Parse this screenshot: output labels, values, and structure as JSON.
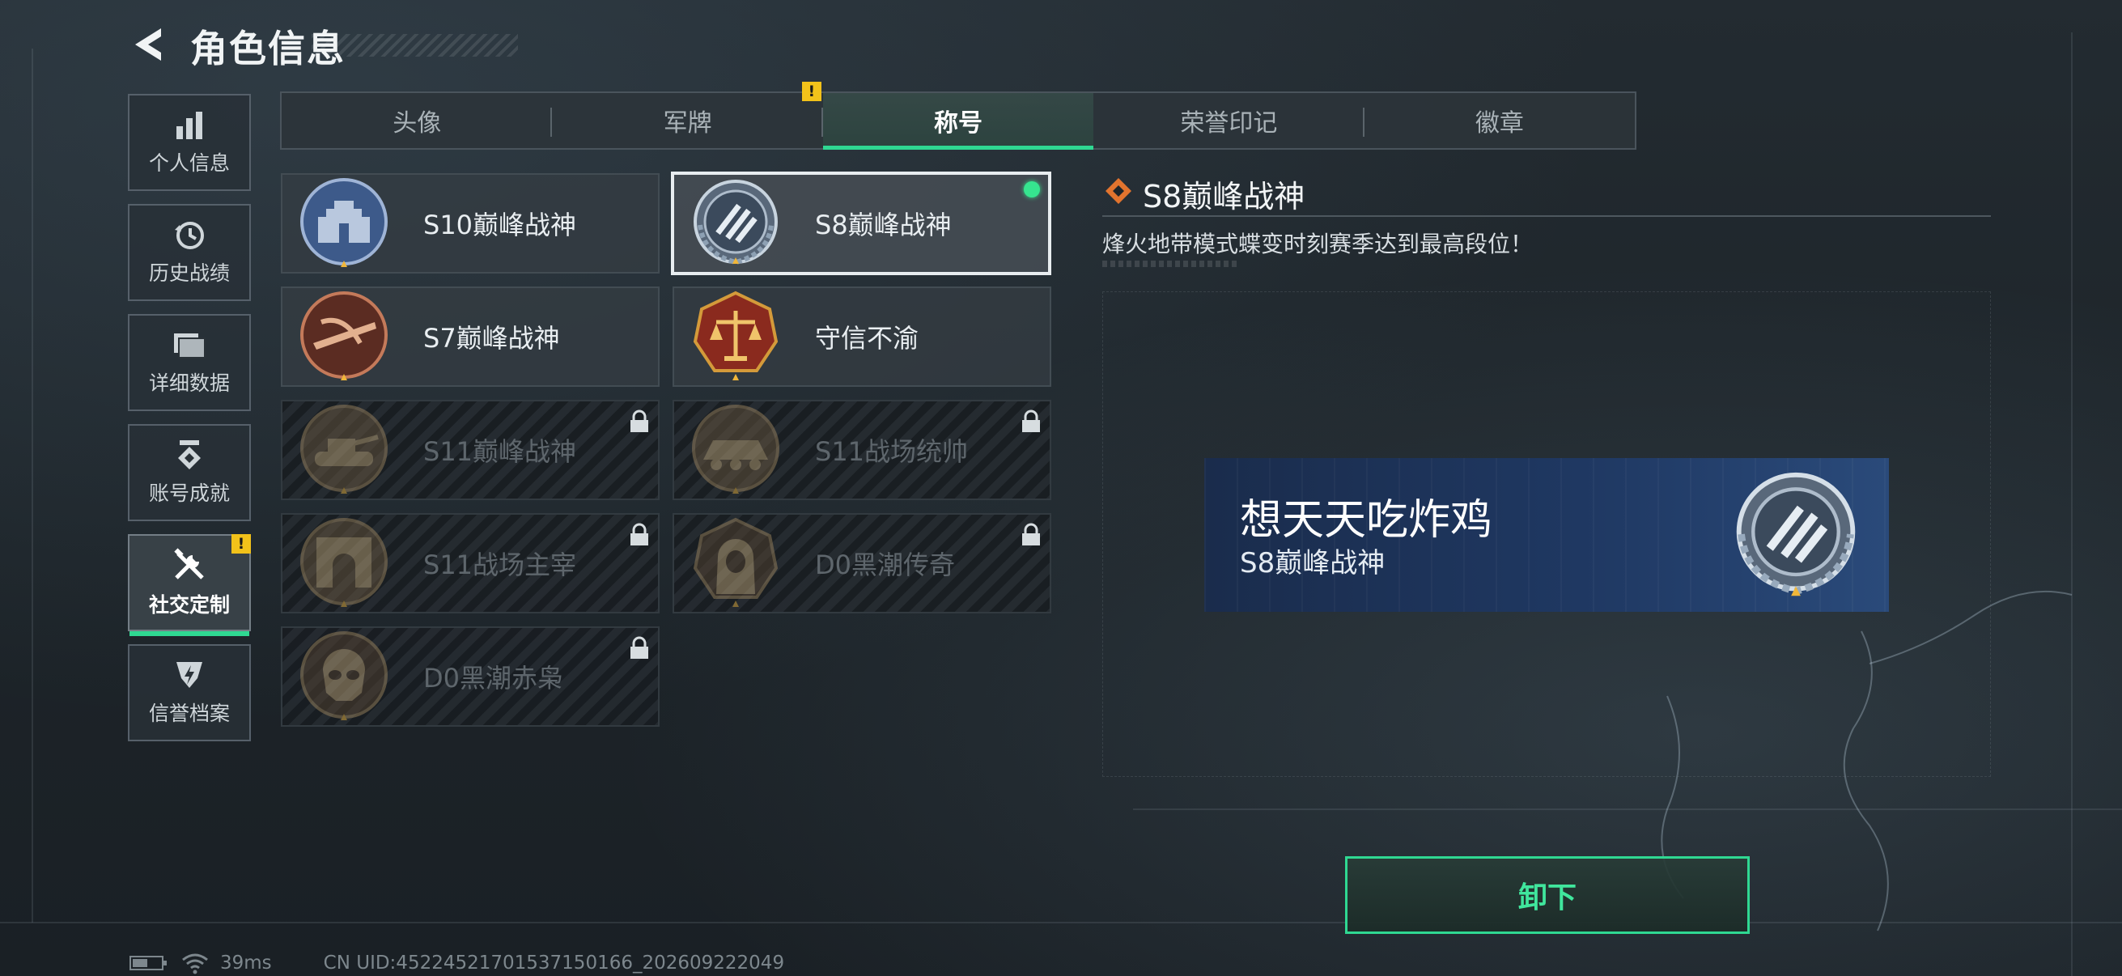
{
  "header": {
    "title": "角色信息"
  },
  "sidebar": {
    "items": [
      {
        "label": "个人信息",
        "icon": "bar-chart-icon"
      },
      {
        "label": "历史战绩",
        "icon": "history-clock-icon"
      },
      {
        "label": "详细数据",
        "icon": "folder-icon"
      },
      {
        "label": "账号成就",
        "icon": "achievement-medal-icon"
      },
      {
        "label": "社交定制",
        "icon": "tools-icon",
        "active": true,
        "badge": "!"
      },
      {
        "label": "信誉档案",
        "icon": "credit-shield-icon"
      }
    ]
  },
  "tabs": [
    {
      "label": "头像"
    },
    {
      "label": "军牌",
      "badge": "!"
    },
    {
      "label": "称号",
      "active": true
    },
    {
      "label": "荣誉印记"
    },
    {
      "label": "徽章"
    }
  ],
  "titles": [
    {
      "label": "S10巅峰战神",
      "locked": false,
      "emblem": "castle-emblem-icon"
    },
    {
      "label": "S8巅峰战神",
      "locked": false,
      "selected": true,
      "equipped": true,
      "emblem": "s8-wreath-emblem-icon"
    },
    {
      "label": "S7巅峰战神",
      "locked": false,
      "emblem": "crossbow-emblem-icon"
    },
    {
      "label": "守信不渝",
      "locked": false,
      "emblem": "scales-emblem-icon"
    },
    {
      "label": "S11巅峰战神",
      "locked": true,
      "emblem": "tank-emblem-icon"
    },
    {
      "label": "S11战场统帅",
      "locked": true,
      "emblem": "apc-emblem-icon"
    },
    {
      "label": "S11战场主宰",
      "locked": true,
      "emblem": "arch-emblem-icon"
    },
    {
      "label": "D0黑潮传奇",
      "locked": true,
      "emblem": "hooded-figure-emblem-icon"
    },
    {
      "label": "D0黑潮赤枭",
      "locked": true,
      "emblem": "skull-mask-emblem-icon"
    }
  ],
  "detail": {
    "title": "S8巅峰战神",
    "description": "烽火地带模式蝶变时刻赛季达到最高段位！",
    "preview": {
      "player_name": "想天天吃炸鸡",
      "title": "S8巅峰战神"
    },
    "unequip_label": "卸下"
  },
  "status": {
    "ping": "39ms",
    "uid": "CN UID:45224521701537150166_202609222049"
  },
  "colors": {
    "accent": "#2fd892",
    "warning": "#f2c21a",
    "equipped_dot": "#36e58f",
    "banner": "#1f3862"
  }
}
